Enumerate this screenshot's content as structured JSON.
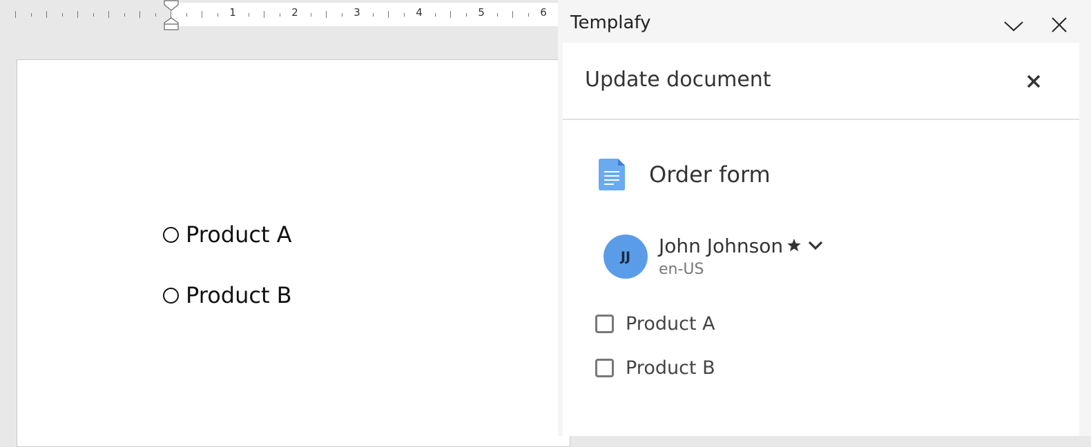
{
  "ruler": {
    "numbers": [
      "1",
      "2",
      "3",
      "4",
      "5",
      "6"
    ]
  },
  "document": {
    "options": [
      {
        "label": "Product A"
      },
      {
        "label": "Product B"
      }
    ]
  },
  "panel": {
    "title": "Templafy",
    "dialog_title": "Update document",
    "document_name": "Order form",
    "user": {
      "initials": "JJ",
      "name": "John Johnson",
      "locale": "en-US"
    },
    "checkboxes": [
      {
        "label": "Product A",
        "checked": false
      },
      {
        "label": "Product B",
        "checked": false
      }
    ]
  },
  "colors": {
    "accent": "#5b9ce8",
    "doc_icon": "#6aaaf1"
  },
  "icons": {
    "collapse": "chevron-down-icon",
    "close": "close-icon",
    "dialog_close": "close-icon",
    "document": "document-icon",
    "favorite": "star-icon",
    "user_menu": "chevron-down-icon"
  }
}
